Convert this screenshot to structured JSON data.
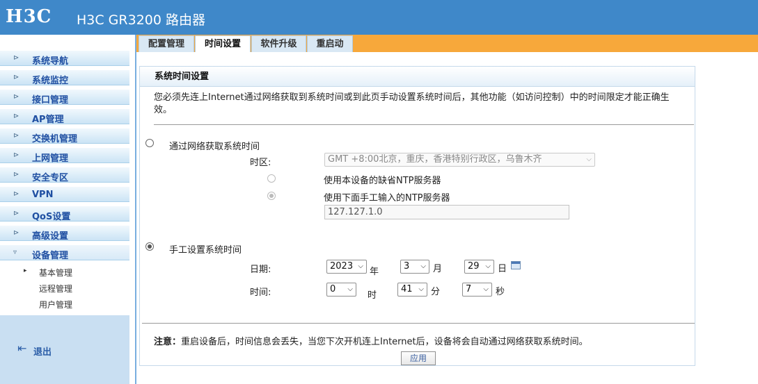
{
  "header": {
    "logo": "H3C",
    "title": "H3C GR3200 路由器"
  },
  "sidebar": {
    "items": [
      {
        "label": "系统导航"
      },
      {
        "label": "系统监控"
      },
      {
        "label": "接口管理"
      },
      {
        "label": "AP管理"
      },
      {
        "label": "交换机管理"
      },
      {
        "label": "上网管理"
      },
      {
        "label": "安全专区"
      },
      {
        "label": "VPN"
      },
      {
        "label": "QoS设置"
      },
      {
        "label": "高级设置"
      },
      {
        "label": "设备管理"
      }
    ],
    "subitems": [
      {
        "label": "基本管理"
      },
      {
        "label": "远程管理"
      },
      {
        "label": "用户管理"
      }
    ],
    "logout": "退出"
  },
  "tabs": [
    {
      "label": "配置管理"
    },
    {
      "label": "时间设置"
    },
    {
      "label": "软件升级"
    },
    {
      "label": "重启动"
    }
  ],
  "panel": {
    "title": "系统时间设置",
    "notice": "您必须先连上Internet通过网络获取到系统时间或到此页手动设置系统时间后，其他功能（如访问控制）中的时间限定才能正确生效。",
    "network_option": "通过网络获取系统时间",
    "timezone_label": "时区:",
    "timezone_value": "GMT +8:00北京，重庆，香港特别行政区，乌鲁木齐",
    "ntp_default": "使用本设备的缺省NTP服务器",
    "ntp_manual": "使用下面手工输入的NTP服务器",
    "ntp_server": "127.127.1.0",
    "manual_option": "手工设置系统时间",
    "date_label": "日期:",
    "year": "2023",
    "year_unit": "年",
    "month": "3",
    "month_unit": "月",
    "day": "29",
    "day_unit": "日",
    "time_label": "时间:",
    "hour": "0",
    "hour_unit": "时",
    "minute": "41",
    "minute_unit": "分",
    "second": "7",
    "second_unit": "秒",
    "note_label": "注意：",
    "note_text": "重启设备后，时间信息会丢失，当您下次开机连上Internet后，设备将会自动通过网络获取系统时间。",
    "apply": "应用"
  }
}
